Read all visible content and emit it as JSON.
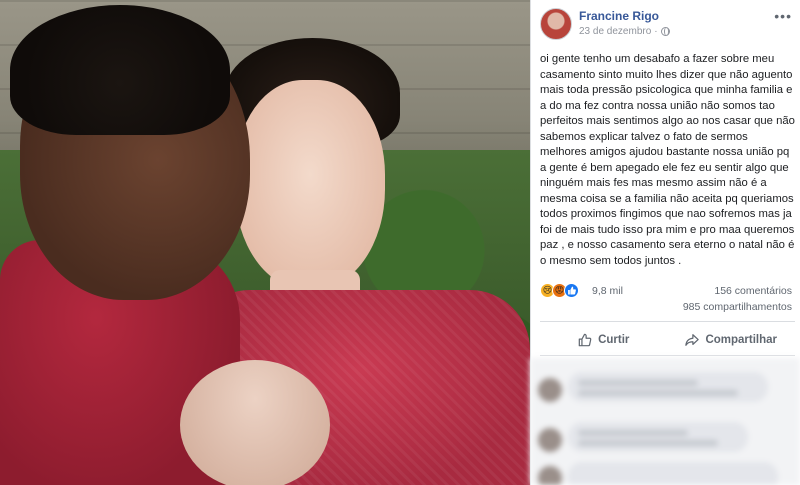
{
  "post": {
    "author": "Francine Rigo",
    "date": "23 de dezembro",
    "more_icon": "more-options-icon",
    "text": "oi gente tenho um desabafo a fazer sobre meu casamento sinto muito lhes dizer que não aguento mais toda pressão psicologica que minha familia e a do ma fez contra nossa união não somos tao perfeitos mais sentimos algo ao nos casar que não sabemos explicar talvez o fato de sermos melhores amigos ajudou bastante nossa união pq a gente é bem apegado ele fez eu sentir algo que ninguém mais fes mas mesmo assim não é a mesma coisa se a familia não aceita pq queriamos todos proximos fingimos que nao sofremos mas ja foi de mais tudo isso pra mim e pro maa queremos paz , e nosso casamento sera eterno o natal não é o mesmo sem todos juntos ."
  },
  "stats": {
    "reactions": "9,8 mil",
    "comments": "156 comentários",
    "shares": "985 compartilhamentos"
  },
  "actions": {
    "like": "Curtir",
    "share": "Compartilhar"
  },
  "colors": {
    "name_link": "#385898",
    "muted": "#90949c",
    "like_blue": "#1877f2"
  }
}
